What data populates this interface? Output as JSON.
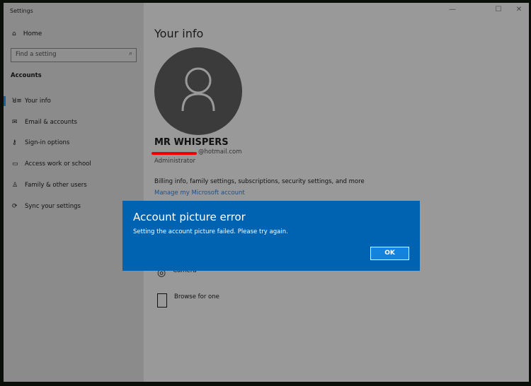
{
  "window": {
    "title": "Settings",
    "minimize": "—",
    "maximize": "☐",
    "close": "✕"
  },
  "sidebar": {
    "home": "Home",
    "search_placeholder": "Find a setting",
    "section": "Accounts",
    "items": [
      {
        "label": "Your info",
        "icon": "ꓤ☰"
      },
      {
        "label": "Email & accounts",
        "icon": "✉"
      },
      {
        "label": "Sign-in options",
        "icon": "⚿"
      },
      {
        "label": "Access work or school",
        "icon": "💼"
      },
      {
        "label": "Family & other users",
        "icon": "⚲"
      },
      {
        "label": "Sync your settings",
        "icon": "⟳"
      }
    ]
  },
  "main": {
    "title": "Your info",
    "name": "MR WHISPERS",
    "email": "@hotmail.com",
    "role": "Administrator",
    "billing": "Billing info, family settings, subscriptions, security settings, and more",
    "manage_link": "Manage my Microsoft account",
    "options": [
      {
        "label": "Camera"
      },
      {
        "label": "Browse for one"
      }
    ]
  },
  "dialog": {
    "title": "Account picture error",
    "message": "Setting the account picture failed. Please try again.",
    "ok": "OK"
  },
  "colors": {
    "accent": "#0063b1",
    "button": "#1383e0",
    "redaction": "#e00000"
  }
}
